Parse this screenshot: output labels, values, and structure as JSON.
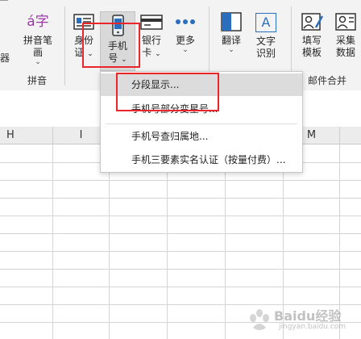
{
  "ribbon": {
    "left_edge_label": "器",
    "groups": [
      {
        "label": "拼音"
      },
      {
        "label": "邮件合并"
      }
    ],
    "buttons": [
      {
        "name": "pinyin",
        "lines": [
          "拼音笔",
          "画"
        ],
        "icon": "pinyin-icon",
        "icon_glyph": "á字"
      },
      {
        "name": "idcard",
        "lines": [
          "身份",
          "证"
        ],
        "icon": "id-card-icon"
      },
      {
        "name": "phone",
        "lines": [
          "手机",
          "号"
        ],
        "icon": "phone-icon"
      },
      {
        "name": "bank",
        "lines": [
          "银行",
          "卡"
        ],
        "icon": "bank-card-icon"
      },
      {
        "name": "more",
        "lines": [
          "更多"
        ],
        "icon": "more-dots-icon"
      },
      {
        "name": "translate",
        "lines": [
          "翻译"
        ],
        "icon": "translate-icon"
      },
      {
        "name": "ocr",
        "lines": [
          "文字",
          "识别"
        ],
        "icon": "text-recognition-icon",
        "icon_glyph": "A"
      },
      {
        "name": "fill-template",
        "lines": [
          "填写",
          "模板"
        ],
        "icon": "fill-template-icon"
      },
      {
        "name": "collect",
        "lines": [
          "采集",
          "数据"
        ],
        "icon": "collect-data-icon"
      }
    ]
  },
  "grid": {
    "columns": [
      "H",
      "I",
      "",
      "",
      "",
      "M"
    ]
  },
  "menu": {
    "items": [
      {
        "label": "分段显示...",
        "highlighted": true
      },
      {
        "label": "手机号部分变星号..."
      },
      {
        "label": "手机号查归属地..."
      },
      {
        "label": "手机三要素实名认证（按量付费）..."
      }
    ]
  },
  "watermark": {
    "text": "Baidu经验",
    "sub": "jingyan.baidu.com"
  },
  "colors": {
    "highlight_box": "#e8262b",
    "accent_blue": "#2a6ebd"
  }
}
